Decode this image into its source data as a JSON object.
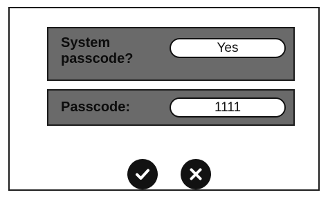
{
  "dialog": {
    "system_passcode": {
      "label": "System\npasscode?",
      "value": "Yes"
    },
    "passcode": {
      "label": "Passcode:",
      "value": "1111"
    },
    "actions": {
      "confirm_icon": "checkmark-icon",
      "cancel_icon": "close-icon"
    }
  },
  "colors": {
    "row_background": "#6a6a6a",
    "field_background": "#ffffff",
    "button_background": "#121212",
    "border": "#1c1c1c"
  }
}
